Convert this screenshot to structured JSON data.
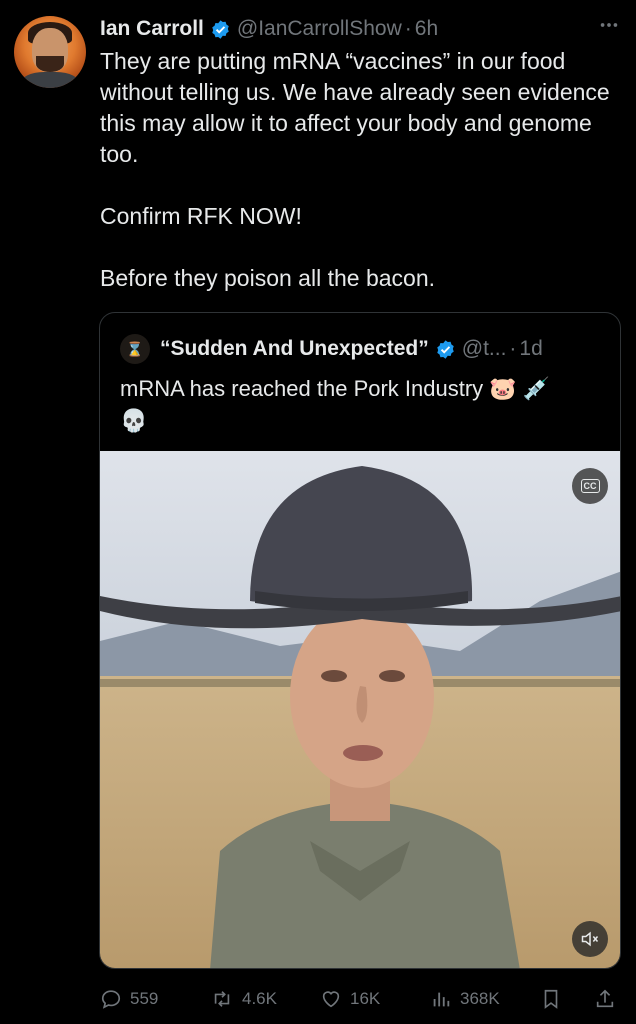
{
  "tweet": {
    "author_name": "Ian Carroll",
    "handle": "@IanCarrollShow",
    "separator": "·",
    "time": "6h",
    "more_icon": "more-dots-icon",
    "text": [
      "They are putting mRNA “vaccines” in our food without telling us. We have already seen evidence this may allow it to affect your body and genome too.",
      "Confirm RFK NOW!",
      "Before they poison all the bacon."
    ]
  },
  "quote": {
    "author_name": "“Sudden And Unexpected”",
    "handle": "@t...",
    "separator": "·",
    "time": "1d",
    "text": "mRNA has reached the Pork Industry 🐷 💉 💀",
    "cc_label": "CC"
  },
  "actions": {
    "replies": "559",
    "reposts": "4.6K",
    "likes": "16K",
    "views": "368K"
  },
  "colors": {
    "background": "#000000",
    "text": "#e7e9ea",
    "muted": "#71767b",
    "verified": "#1d9bf0",
    "border": "#2f3336"
  }
}
